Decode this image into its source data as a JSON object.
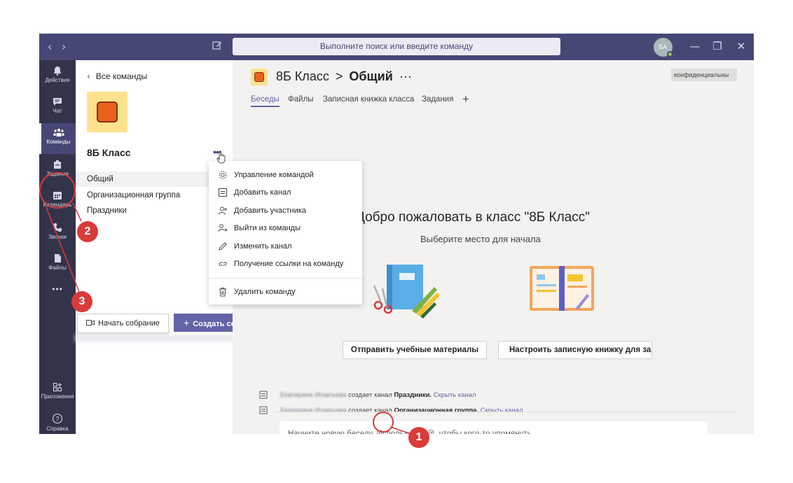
{
  "titlebar": {
    "back_glyph": "‹",
    "forward_glyph": "›",
    "search_placeholder": "Выполните поиск или введите команду",
    "avatar_initials": "БА",
    "minimize": "—",
    "maximize": "❐",
    "close": "✕"
  },
  "rail": {
    "items": [
      {
        "label": "Действия",
        "icon": "bell-icon"
      },
      {
        "label": "Чат",
        "icon": "chat-icon"
      },
      {
        "label": "Команды",
        "icon": "teams-icon"
      },
      {
        "label": "Задания",
        "icon": "assignments-icon"
      },
      {
        "label": "Календарь",
        "icon": "calendar-icon"
      },
      {
        "label": "Звонки",
        "icon": "phone-icon"
      },
      {
        "label": "Файлы",
        "icon": "file-icon"
      },
      {
        "label": "Приложения",
        "icon": "apps-icon"
      },
      {
        "label": "Справка",
        "icon": "help-icon"
      }
    ],
    "more": "•••",
    "active_color": "#464775"
  },
  "panel": {
    "back_label": "Все команды",
    "team_name": "8Б Класс",
    "more": "•••",
    "channels": [
      "Общий",
      "Организационная группа",
      "Праздники"
    ],
    "start_meeting": "Начать собрание",
    "create_meeting": "Создать собрание"
  },
  "menu": {
    "items": [
      {
        "label": "Управление командой",
        "icon": "gear-icon"
      },
      {
        "label": "Добавить канал",
        "icon": "channel-icon"
      },
      {
        "label": "Добавить участника",
        "icon": "add-person-icon"
      },
      {
        "label": "Выйти из команды",
        "icon": "leave-icon"
      },
      {
        "label": "Изменить канал",
        "icon": "pencil-icon"
      },
      {
        "label": "Получение ссылки на команду",
        "icon": "link-icon"
      },
      {
        "label": "Удалить команду",
        "icon": "trash-icon"
      }
    ]
  },
  "main": {
    "team": "8Б Класс",
    "separator": ">",
    "channel": "Общий",
    "more": "···",
    "confidential": "конфиденциальны",
    "tabs": [
      "Беседы",
      "Файлы",
      "Записная книжка класса",
      "Задания"
    ],
    "add_tab": "+",
    "welcome_title": "Добро пожаловать в класс \"8Б Класс\"",
    "welcome_sub": "Выберите место для начала",
    "btn_upload": "Отправить учебные материалы",
    "btn_notebook": "Настроить записную книжку для зан",
    "feed": [
      {
        "author": "Екатерина Игнатьева",
        "action": "создает канал",
        "channel": "Праздники.",
        "link": "Скрыть канал"
      },
      {
        "author": "Екатерина Игнатьева",
        "action": "создает канал",
        "channel": "Организационная группа.",
        "link": "Скрыть канал"
      }
    ],
    "compose_placeholder": "Начните новую беседу. Используйте @, чтобы кого-то упомянуть.",
    "compose_more": "•••"
  },
  "annotations": {
    "markers": [
      "1",
      "2",
      "3"
    ],
    "color": "#d93a3a"
  },
  "colors": {
    "brand": "#6264a7",
    "titlebar": "#464775",
    "rail": "#33344a"
  }
}
